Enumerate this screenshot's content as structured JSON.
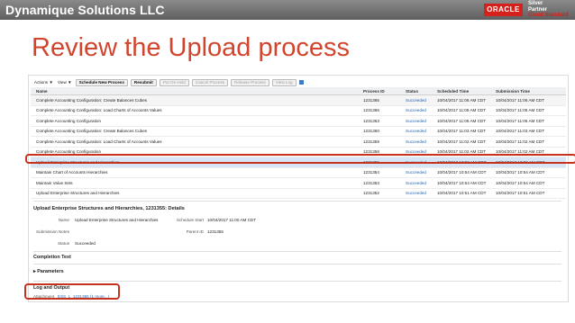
{
  "header": {
    "company": "Dynamique Solutions LLC",
    "oracle": "ORACLE",
    "badge_line1": "Silver",
    "badge_line2": "Partner",
    "badge_line3": "Cloud Standard"
  },
  "slide_title": "Review the Upload process",
  "toolbar": {
    "actions": "Actions ▼",
    "view": "View ▼",
    "schedule": "Schedule New Process",
    "resubmit": "Resubmit",
    "put_on_hold": "Put On Hold",
    "cancel": "Cancel Process",
    "release": "Release Process",
    "view_log": "View Log"
  },
  "table": {
    "columns": [
      "Name",
      "Process ID",
      "Status",
      "Scheduled Time",
      "Submission Time"
    ],
    "rows": [
      {
        "name": "Complete Accounting Configuration: Create Balances Cubes",
        "id": "1231365",
        "status": "Succeeded",
        "sched": "10/04/2017 11:06 AM CDT",
        "sub": "10/04/2017 11:06 AM CDT"
      },
      {
        "name": "Complete Accounting Configuration: Load Charts of Accounts Values",
        "id": "1231366",
        "status": "Succeeded",
        "sched": "10/04/2017 11:06 AM CDT",
        "sub": "10/04/2017 11:06 AM CDT"
      },
      {
        "name": "Complete Accounting Configuration",
        "id": "1231363",
        "status": "Succeeded",
        "sched": "10/04/2017 11:06 AM CDT",
        "sub": "10/04/2017 11:06 AM CDT"
      },
      {
        "name": "Complete Accounting Configuration: Create Balances Cubes",
        "id": "1231360",
        "status": "Succeeded",
        "sched": "10/04/2017 11:03 AM CDT",
        "sub": "10/04/2017 11:03 AM CDT"
      },
      {
        "name": "Complete Accounting Configuration: Load Charts of Accounts Values",
        "id": "1231359",
        "status": "Succeeded",
        "sched": "10/04/2017 11:02 AM CDT",
        "sub": "10/04/2017 11:02 AM CDT"
      },
      {
        "name": "Complete Accounting Configuration",
        "id": "1231358",
        "status": "Succeeded",
        "sched": "10/04/2017 11:02 AM CDT",
        "sub": "10/04/2017 11:02 AM CDT"
      },
      {
        "name": "Upload Enterprise Structures and Hierarchies",
        "id": "1231355",
        "status": "Succeeded",
        "sched": "10/04/2017 10:59 AM CDT",
        "sub": "10/04/2017 10:59 AM CDT"
      },
      {
        "name": "Maintain Chart of Accounts Hierarchies",
        "id": "1231354",
        "status": "Succeeded",
        "sched": "10/04/2017 10:54 AM CDT",
        "sub": "10/04/2017 10:54 AM CDT"
      },
      {
        "name": "Maintain Value Sets",
        "id": "1231353",
        "status": "Succeeded",
        "sched": "10/04/2017 10:54 AM CDT",
        "sub": "10/04/2017 10:54 AM CDT"
      },
      {
        "name": "Upload Enterprise Structures and Hierarchies",
        "id": "1231352",
        "status": "Succeeded",
        "sched": "10/04/2017 10:51 AM CDT",
        "sub": "10/04/2017 10:51 AM CDT"
      }
    ]
  },
  "details": {
    "title": "Upload Enterprise Structures and Hierarchies, 1231355: Details",
    "name_label": "Name",
    "name_value": "Upload Enterprise Structures and Hierarchies",
    "schedule_label": "Schedule Start",
    "schedule_value": "10/04/2017 11:00 AM CDT",
    "notes_label": "Submission Notes",
    "parent_label": "Parent ID",
    "parent_value": "1231355",
    "status_label": "Status",
    "status_value": "Succeeded",
    "completion_title": "Completion Text",
    "parameters": "▸ Parameters",
    "log_title": "Log and Output",
    "attachment_label": "Attachment",
    "attachment_value": "ESS_L_1231355 (1 more...)"
  }
}
